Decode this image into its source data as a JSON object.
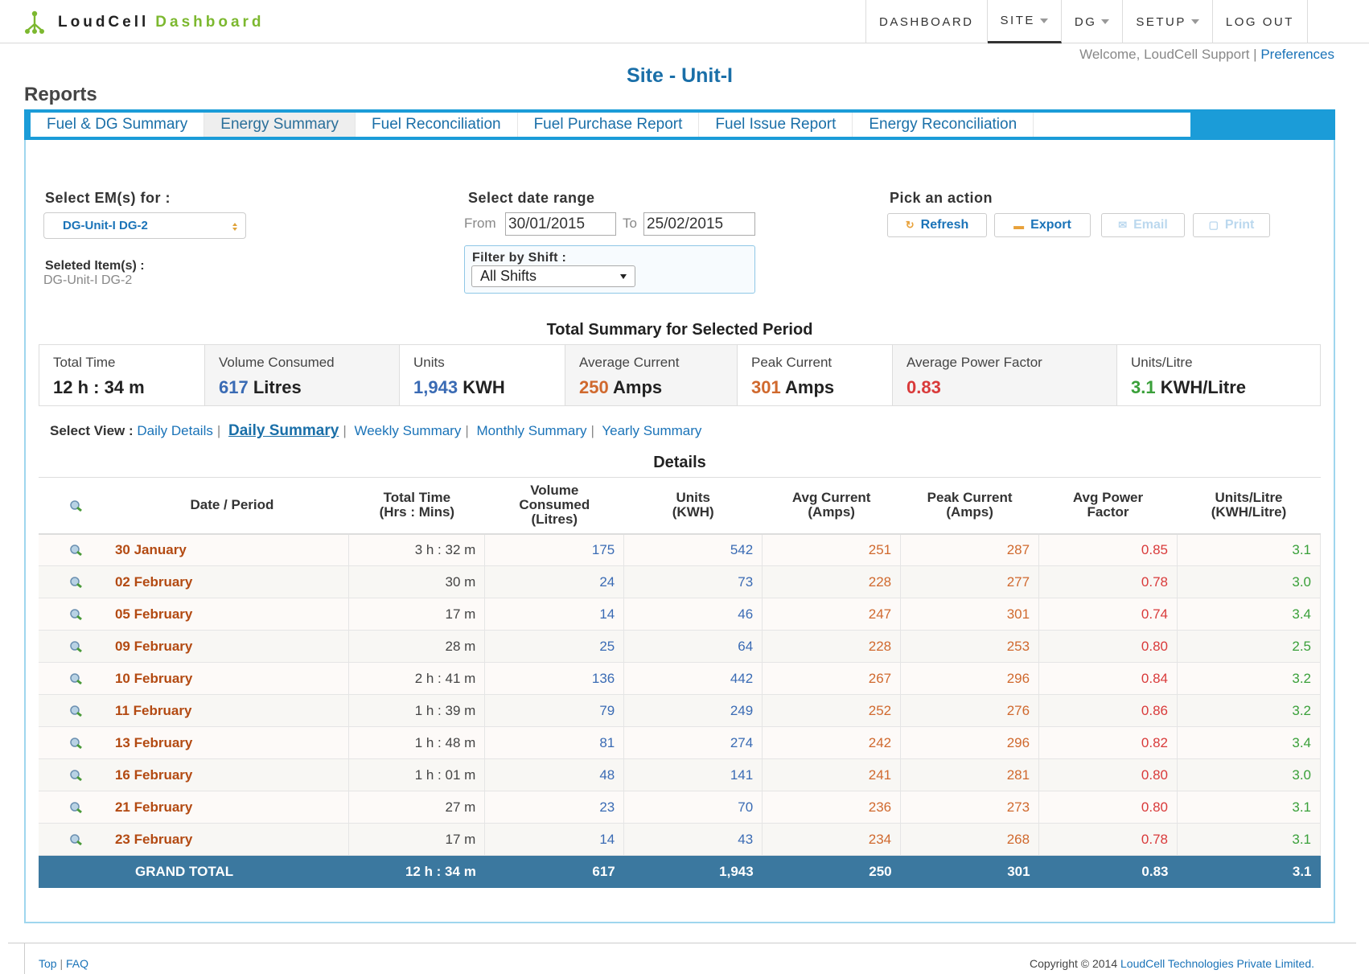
{
  "brand": {
    "name": "LoudCell",
    "suffix": "Dashboard",
    "accent": "#7cb82f"
  },
  "nav": [
    {
      "label": "DASHBOARD",
      "caret": false
    },
    {
      "label": "SITE",
      "caret": true
    },
    {
      "label": "DG",
      "caret": true
    },
    {
      "label": "SETUP",
      "caret": true
    },
    {
      "label": "LOG OUT",
      "caret": false
    }
  ],
  "welcome": {
    "text": "Welcome, LoudCell Support |",
    "link": "Preferences"
  },
  "site_title": "Site - Unit-I",
  "reports_title": "Reports",
  "tabs": [
    {
      "label": "Fuel & DG Summary",
      "active": false
    },
    {
      "label": "Energy Summary",
      "active": true
    },
    {
      "label": "Fuel Reconciliation",
      "active": false
    },
    {
      "label": "Fuel Purchase Report",
      "active": false
    },
    {
      "label": "Fuel Issue Report",
      "active": false
    },
    {
      "label": "Energy Reconciliation",
      "active": false
    }
  ],
  "filters": {
    "em_label": "Select EM(s) for :",
    "em_value": "DG-Unit-I DG-2",
    "selected_label": "Seleted Item(s) :",
    "selected_value": "DG-Unit-I DG-2",
    "date_label": "Select date range",
    "from_label": "From",
    "from_value": "30/01/2015",
    "to_label": "To",
    "to_value": "25/02/2015",
    "shift_label": "Filter by Shift :",
    "shift_value": "All Shifts",
    "action_label": "Pick an action",
    "refresh": "Refresh",
    "export": "Export",
    "email": "Email",
    "print": "Print"
  },
  "summary_title": "Total Summary for Selected Period",
  "summary": [
    {
      "label": "Total Time",
      "value": "12 h : 34 m",
      "unit": "",
      "color": "#222222"
    },
    {
      "label": "Volume Consumed",
      "value": "617",
      "unit": "Litres",
      "color": "#3a6bb4"
    },
    {
      "label": "Units",
      "value": "1,943",
      "unit": "KWH",
      "color": "#3a6bb4"
    },
    {
      "label": "Average Current",
      "value": "250",
      "unit": "Amps",
      "color": "#d0692e"
    },
    {
      "label": "Peak Current",
      "value": "301",
      "unit": "Amps",
      "color": "#d0692e"
    },
    {
      "label": "Average Power Factor",
      "value": "0.83",
      "unit": "",
      "color": "#d93a3a"
    },
    {
      "label": "Units/Litre",
      "value": "3.1",
      "unit": "KWH/Litre",
      "color": "#3aa03a"
    }
  ],
  "view": {
    "label": "Select View :",
    "options": [
      "Daily Details",
      "Daily Summary",
      "Weekly Summary",
      "Monthly Summary",
      "Yearly Summary"
    ],
    "current": "Daily Summary"
  },
  "details_title": "Details",
  "table": {
    "headers": [
      [
        "Date / Period"
      ],
      [
        "Total Time",
        "(Hrs : Mins)"
      ],
      [
        "Volume",
        "Consumed",
        "(Litres)"
      ],
      [
        "Units",
        "(KWH)"
      ],
      [
        "Avg Current",
        "(Amps)"
      ],
      [
        "Peak Current",
        "(Amps)"
      ],
      [
        "Avg Power",
        "Factor"
      ],
      [
        "Units/Litre",
        "(KWH/Litre)"
      ]
    ],
    "rows": [
      [
        "30 January",
        "3 h : 32 m",
        "175",
        "542",
        "251",
        "287",
        "0.85",
        "3.1"
      ],
      [
        "02 February",
        "30 m",
        "24",
        "73",
        "228",
        "277",
        "0.78",
        "3.0"
      ],
      [
        "05 February",
        "17 m",
        "14",
        "46",
        "247",
        "301",
        "0.74",
        "3.4"
      ],
      [
        "09 February",
        "28 m",
        "25",
        "64",
        "228",
        "253",
        "0.80",
        "2.5"
      ],
      [
        "10 February",
        "2 h : 41 m",
        "136",
        "442",
        "267",
        "296",
        "0.84",
        "3.2"
      ],
      [
        "11 February",
        "1 h : 39 m",
        "79",
        "249",
        "252",
        "276",
        "0.86",
        "3.2"
      ],
      [
        "13 February",
        "1 h : 48 m",
        "81",
        "274",
        "242",
        "296",
        "0.82",
        "3.4"
      ],
      [
        "16 February",
        "1 h : 01 m",
        "48",
        "141",
        "241",
        "281",
        "0.80",
        "3.0"
      ],
      [
        "21 February",
        "27 m",
        "23",
        "70",
        "236",
        "273",
        "0.80",
        "3.1"
      ],
      [
        "23 February",
        "17 m",
        "14",
        "43",
        "234",
        "268",
        "0.78",
        "3.1"
      ]
    ],
    "total": [
      "GRAND TOTAL",
      "12 h : 34 m",
      "617",
      "1,943",
      "250",
      "301",
      "0.83",
      "3.1"
    ]
  },
  "footer": {
    "top": "Top",
    "faq": "FAQ",
    "copyright": "Copyright © 2014",
    "company": "LoudCell Technologies Private Limited."
  }
}
